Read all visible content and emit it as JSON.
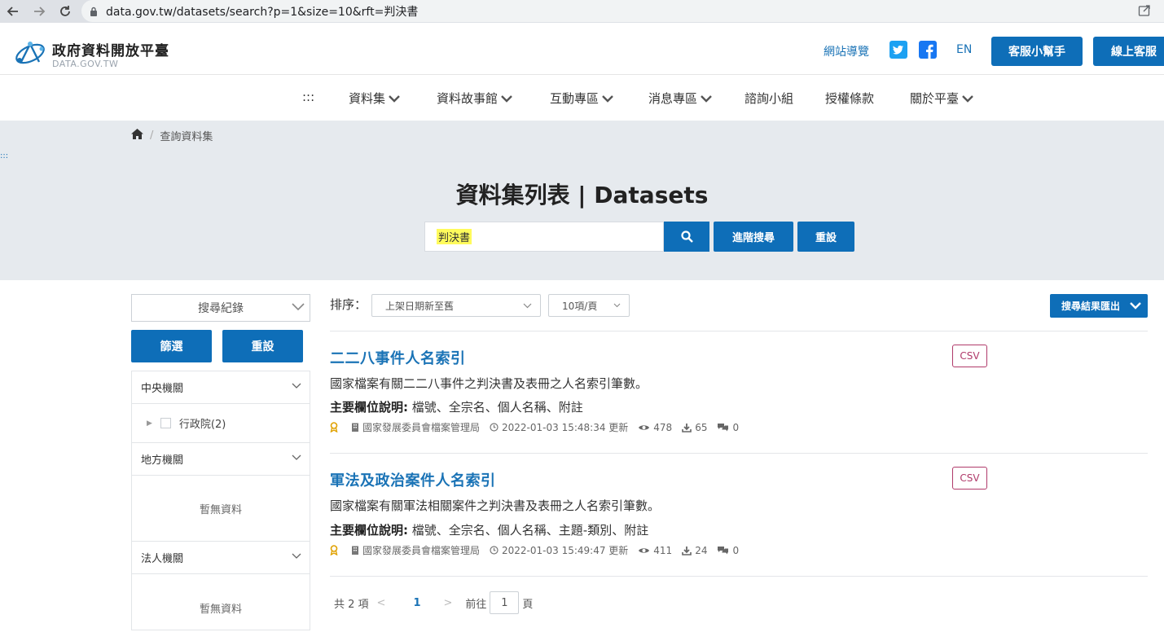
{
  "browser": {
    "url": "data.gov.tw/datasets/search?p=1&size=10&rft=判決書"
  },
  "header": {
    "logo_title": "政府資料開放平臺",
    "logo_sub": "DATA.GOV.TW",
    "sitemap": "網站導覽",
    "lang": "EN",
    "help_btn": "客服小幫手",
    "chat_btn": "線上客服"
  },
  "nav": {
    "dots": ":::",
    "items": [
      "資料集",
      "資料故事館",
      "互動專區",
      "消息專區",
      "諮詢小組",
      "授權條款",
      "關於平臺"
    ]
  },
  "hero": {
    "breadcrumb": "查詢資料集",
    "side_dots": ":::",
    "title": "資料集列表 | Datasets",
    "search_value": "判決書",
    "advanced_btn": "進階搜尋",
    "reset_btn": "重設"
  },
  "sidebar": {
    "history": "搜尋紀錄",
    "filter_btn": "篩選",
    "reset_btn": "重設",
    "panels": {
      "central": {
        "title": "中央機關",
        "item": "行政院(2)"
      },
      "local": {
        "title": "地方機關",
        "empty": "暫無資料"
      },
      "corp": {
        "title": "法人機關",
        "empty": "暫無資料"
      }
    }
  },
  "results": {
    "sort_label": "排序：",
    "sort_value": "上架日期新至舊",
    "size_value": "10項/頁",
    "export_btn": "搜尋結果匯出",
    "fields_label": "主要欄位說明:",
    "items": [
      {
        "title": "二二八事件人名索引",
        "format": "CSV",
        "desc": "國家檔案有關二二八事件之判決書及表冊之人名索引筆數。",
        "fields": "檔號、全宗名、個人名稱、附註",
        "org": "國家發展委員會檔案管理局",
        "updated": "2022-01-03 15:48:34 更新",
        "views": "478",
        "downloads": "65",
        "comments": "0"
      },
      {
        "title": "軍法及政治案件人名索引",
        "format": "CSV",
        "desc": "國家檔案有關軍法相關案件之判決書及表冊之人名索引筆數。",
        "fields": "檔號、全宗名、個人名稱、主題-類別、附註",
        "org": "國家發展委員會檔案管理局",
        "updated": "2022-01-03 15:49:47 更新",
        "views": "411",
        "downloads": "24",
        "comments": "0"
      }
    ]
  },
  "pager": {
    "total": "共 2 項",
    "current": "1",
    "goto_label": "前往",
    "goto_value": "1",
    "page_unit": "頁"
  },
  "colors": {
    "primary": "#0e6eb8",
    "link": "#1a73b6",
    "hero_bg": "#e6eaee",
    "csv": "#b03a6a"
  }
}
